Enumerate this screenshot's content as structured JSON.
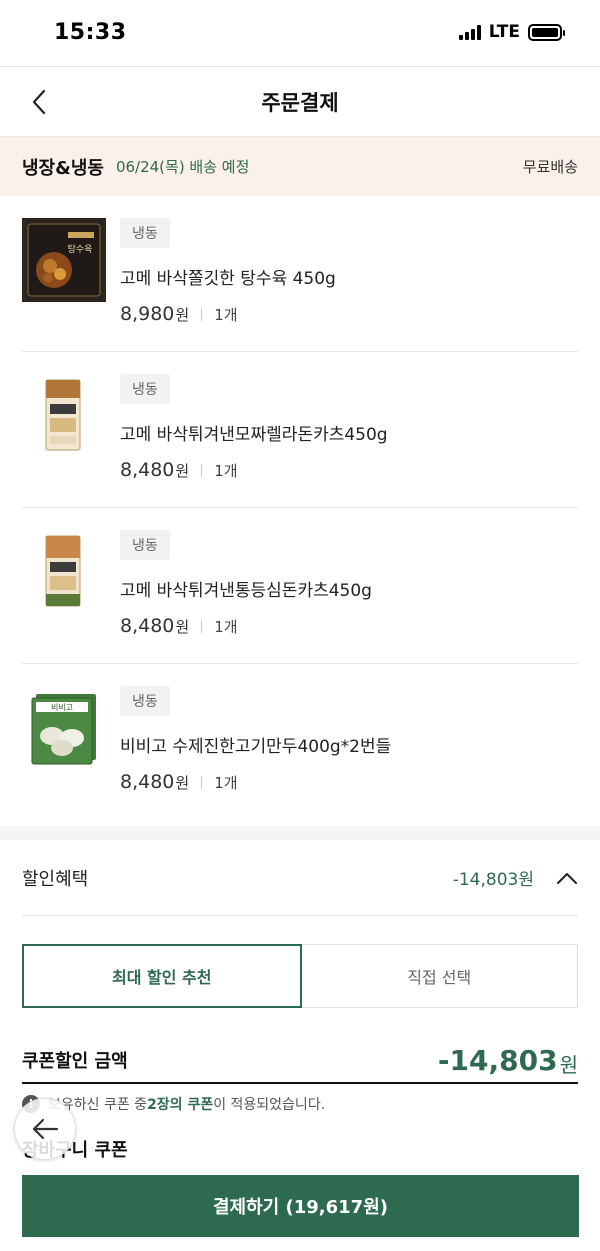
{
  "status": {
    "time": "15:33",
    "network": "LTE"
  },
  "header": {
    "title": "주문결제"
  },
  "delivery": {
    "type": "냉장&냉동",
    "date": "06/24(목) 배송 예정",
    "fee": "무료배송"
  },
  "items": [
    {
      "tag": "냉동",
      "name": "고메 바삭쫄깃한 탕수육 450g",
      "price": "8,980",
      "unit": "원",
      "qty": "1개",
      "thumb_text": "탕수육"
    },
    {
      "tag": "냉동",
      "name": "고메 바삭튀겨낸모짜렐라돈카츠450g",
      "price": "8,480",
      "unit": "원",
      "qty": "1개"
    },
    {
      "tag": "냉동",
      "name": "고메 바삭튀겨낸통등심돈카츠450g",
      "price": "8,480",
      "unit": "원",
      "qty": "1개"
    },
    {
      "tag": "냉동",
      "name": "비비고 수제진한고기만두400g*2번들",
      "price": "8,480",
      "unit": "원",
      "qty": "1개",
      "thumb_text": "비비고"
    }
  ],
  "discount": {
    "label": "할인혜택",
    "amount": "-14,803원",
    "tabs": [
      "최대 할인 추천",
      "직접 선택"
    ],
    "coupon_label": "쿠폰할인 금액",
    "coupon_amount": "-14,803",
    "coupon_unit": "원",
    "notice_pre": "보유하신 쿠폰 중 ",
    "notice_hl": "2장의 쿠폰",
    "notice_post": "이 적용되었습니다.",
    "section_title": "장바구니 쿠폰"
  },
  "pay_button": "결제하기 (19,617원)",
  "colors": {
    "accent": "#2d6a4f",
    "banner_bg": "#fcf1ea"
  }
}
